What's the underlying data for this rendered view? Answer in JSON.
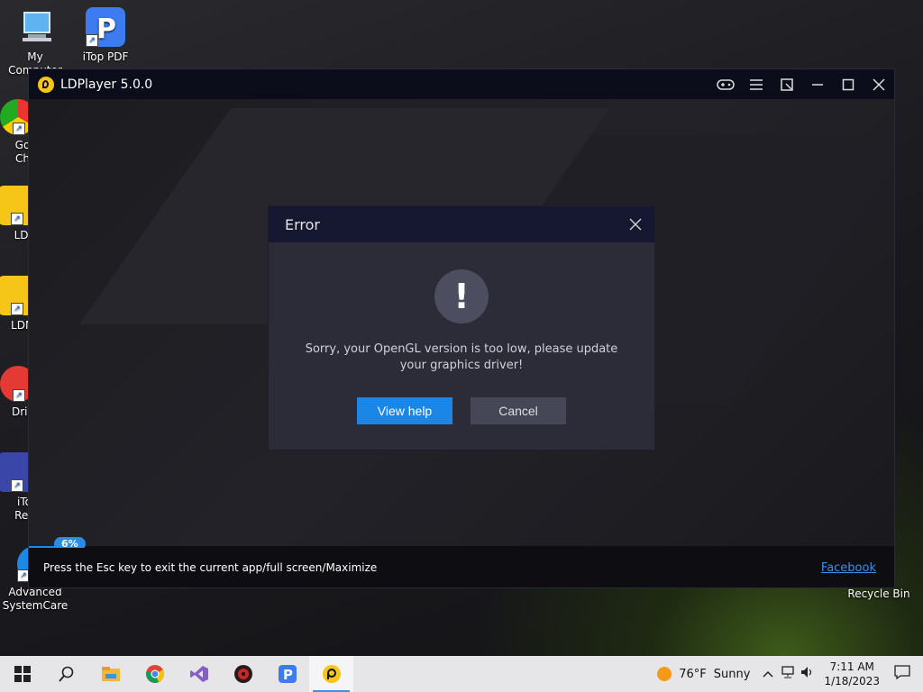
{
  "desktop": {
    "icons": [
      {
        "label": "My Computer"
      },
      {
        "label": "iTop PDF"
      },
      {
        "label": "Go Ch"
      },
      {
        "label": "LDF"
      },
      {
        "label": "LDMu"
      },
      {
        "label": "Drive"
      },
      {
        "label": "iTo Rec"
      },
      {
        "label": "Advanced SystemCare"
      },
      {
        "label": "Recycle Bin"
      }
    ]
  },
  "window": {
    "title": "LDPlayer 5.0.0",
    "controls": [
      "gamepad-icon",
      "menu-icon",
      "resize-icon",
      "minimize-icon",
      "maximize-icon",
      "close-icon"
    ],
    "progress": {
      "label": "6%",
      "value": 0.06
    },
    "status_text": "Press the Esc key to exit the current app/full screen/Maximize",
    "status_link": "Facebook"
  },
  "dialog": {
    "title": "Error",
    "icon": "!",
    "message": "Sorry, your OpenGL version is too low, please update your graphics driver!",
    "primary_button": "View help",
    "secondary_button": "Cancel"
  },
  "taskbar": {
    "apps": [
      "start-icon",
      "search-icon",
      "file-explorer-icon",
      "chrome-icon",
      "visual-studio-icon",
      "game-icon",
      "itop-pdf-icon",
      "ldplayer-icon"
    ],
    "weather_temp": "76°F",
    "weather_text": "Sunny",
    "time": "7:11 AM",
    "date": "1/18/2023"
  },
  "colors": {
    "accent": "#1a86e8",
    "dialog_bg": "#2c2c38",
    "title_bg": "#0c0d1a"
  }
}
